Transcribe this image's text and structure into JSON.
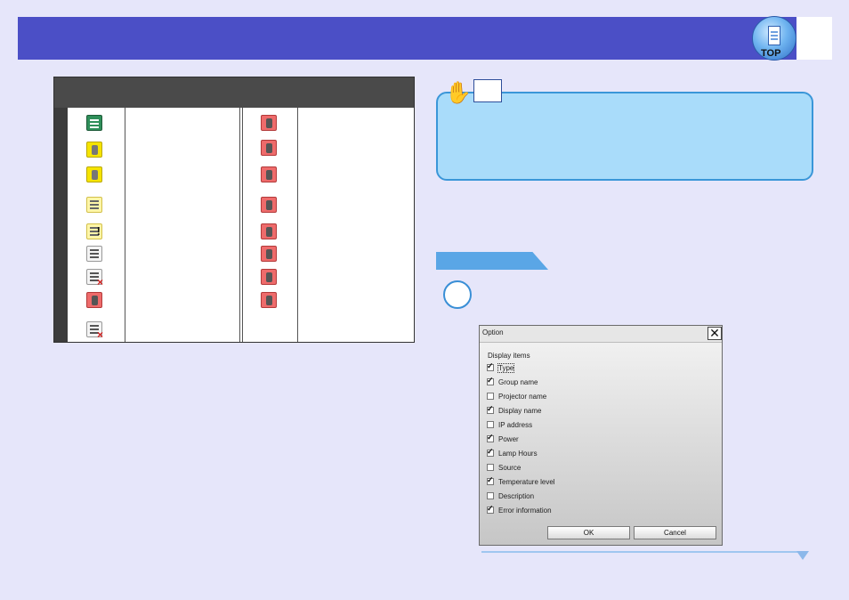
{
  "header": {
    "logo_text": "TOP"
  },
  "dialog": {
    "title": "Option",
    "close_glyph": "✕",
    "section_label": "Display items",
    "options": [
      {
        "label": "Type",
        "checked": true
      },
      {
        "label": "Group name",
        "checked": true
      },
      {
        "label": "Projector name",
        "checked": false
      },
      {
        "label": "Display name",
        "checked": true
      },
      {
        "label": "IP address",
        "checked": false
      },
      {
        "label": "Power",
        "checked": true
      },
      {
        "label": "Lamp Hours",
        "checked": true
      },
      {
        "label": "Source",
        "checked": false
      },
      {
        "label": "Temperature level",
        "checked": true
      },
      {
        "label": "Description",
        "checked": false
      },
      {
        "label": "Error information",
        "checked": true
      }
    ],
    "ok_label": "OK",
    "cancel_label": "Cancel"
  },
  "icons": {
    "left_column": [
      "monitor-green-icon",
      "projector-yellow-icon",
      "thermometer-yellow-icon",
      "network-yellow-icon",
      "warning-list-icon",
      "list-search-icon",
      "list-error-icon",
      "list-download-icon",
      "list-error-icon"
    ],
    "right_column": [
      "projector-red-icon",
      "projector-red-icon",
      "projector-red-question-icon",
      "thermometer-red-icon",
      "lamp-red-icon",
      "fan-red-icon",
      "filter-red-icon",
      "hardware-red-icon"
    ]
  },
  "colors": {
    "header": "#4b4fc6",
    "tip_fill": "#a9dcfa",
    "tip_border": "#3a96d8",
    "page_bg": "#e6e6fa"
  }
}
